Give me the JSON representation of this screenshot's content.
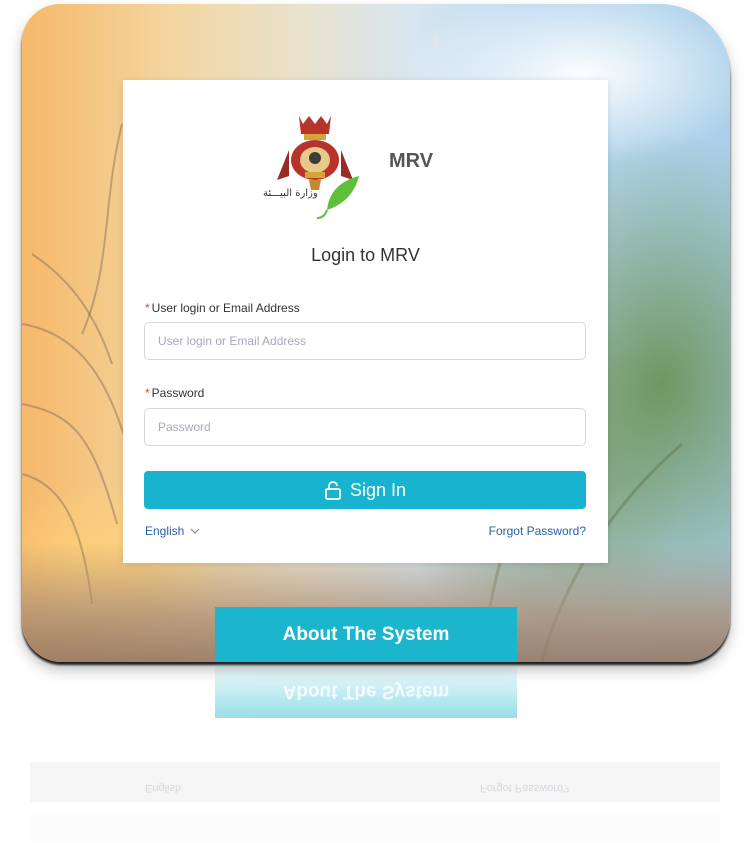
{
  "brand": {
    "name": "MRV",
    "ministry_text": "وزارة البيـــئة"
  },
  "login": {
    "title": "Login to MRV",
    "username": {
      "label": "User login or Email Address",
      "placeholder": "User login or Email Address",
      "required_mark": "*"
    },
    "password": {
      "label": "Password",
      "placeholder": "Password",
      "required_mark": "*"
    },
    "sign_in_label": "Sign In",
    "language_label": "English",
    "forgot_label": "Forgot Password?"
  },
  "about_label": "About The System",
  "colors": {
    "accent": "#17b3cf",
    "link": "#2b5fa8",
    "required": "#e0443d"
  },
  "icons": {
    "sign_in": "unlock-icon",
    "language": "chevron-down-icon"
  }
}
